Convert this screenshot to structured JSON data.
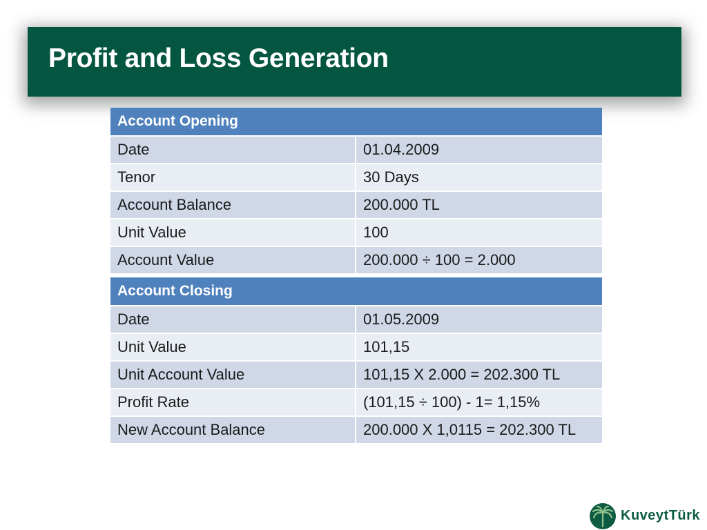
{
  "slide": {
    "title": "Profit and Loss Generation"
  },
  "opening": {
    "header": "Account Opening",
    "rows": [
      {
        "label": "Date",
        "value": "01.04.2009"
      },
      {
        "label": "Tenor",
        "value": "30 Days"
      },
      {
        "label": "Account Balance",
        "value": "200.000 TL"
      },
      {
        "label": "Unit Value",
        "value": "100"
      },
      {
        "label": "Account Value",
        "value": "200.000 ÷ 100 = 2.000"
      }
    ]
  },
  "closing": {
    "header": "Account Closing",
    "rows": [
      {
        "label": "Date",
        "value": "01.05.2009"
      },
      {
        "label": "Unit Value",
        "value": "101,15"
      },
      {
        "label": "Unit  Account Value",
        "value": "101,15  X  2.000 = 202.300 TL"
      },
      {
        "label": "Profit Rate",
        "value": "(101,15 ÷ 100) - 1= 1,15%"
      },
      {
        "label": "New Account Balance",
        "value": "200.000 X 1,0115 = 202.300 TL"
      }
    ]
  },
  "logo": {
    "text": "KuveytTürk",
    "icon": "palm-tree-icon",
    "color": "#0d5b43"
  },
  "colors": {
    "title_bar": "#055640",
    "header_row": "#4f81bd",
    "row_dark": "#d0d8e8",
    "row_light": "#e9edf4"
  }
}
